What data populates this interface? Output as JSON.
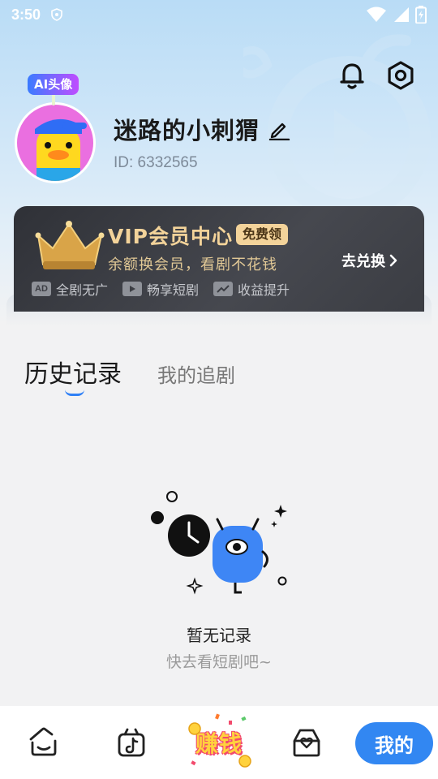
{
  "status_bar": {
    "time": "3:50"
  },
  "profile": {
    "ai_badge": "AI头像",
    "username": "迷路的小刺猬",
    "user_id": "ID: 6332565"
  },
  "vip": {
    "title": "VIP会员中心",
    "tag": "免费领",
    "subtitle": "余额换会员，看剧不花钱",
    "action": "去兑换",
    "perks": [
      {
        "icon": "AD",
        "label": "全剧无广"
      },
      {
        "icon": "play-icon",
        "label": "畅享短剧"
      },
      {
        "icon": "trend-icon",
        "label": "收益提升"
      }
    ],
    "colors": {
      "gold": "#f3d39a",
      "card_bg": "#3b3d43"
    }
  },
  "tabs": [
    {
      "label": "历史记录",
      "active": true
    },
    {
      "label": "我的追剧",
      "active": false
    }
  ],
  "empty": {
    "title": "暂无记录",
    "subtitle": "快去看短剧吧~"
  },
  "bottom_nav": {
    "items": [
      {
        "icon": "home-icon"
      },
      {
        "icon": "video-icon"
      },
      {
        "label": "赚钱"
      },
      {
        "icon": "mailbox-icon"
      },
      {
        "label": "我的",
        "active": true
      }
    ],
    "accent": "#3287f2"
  }
}
